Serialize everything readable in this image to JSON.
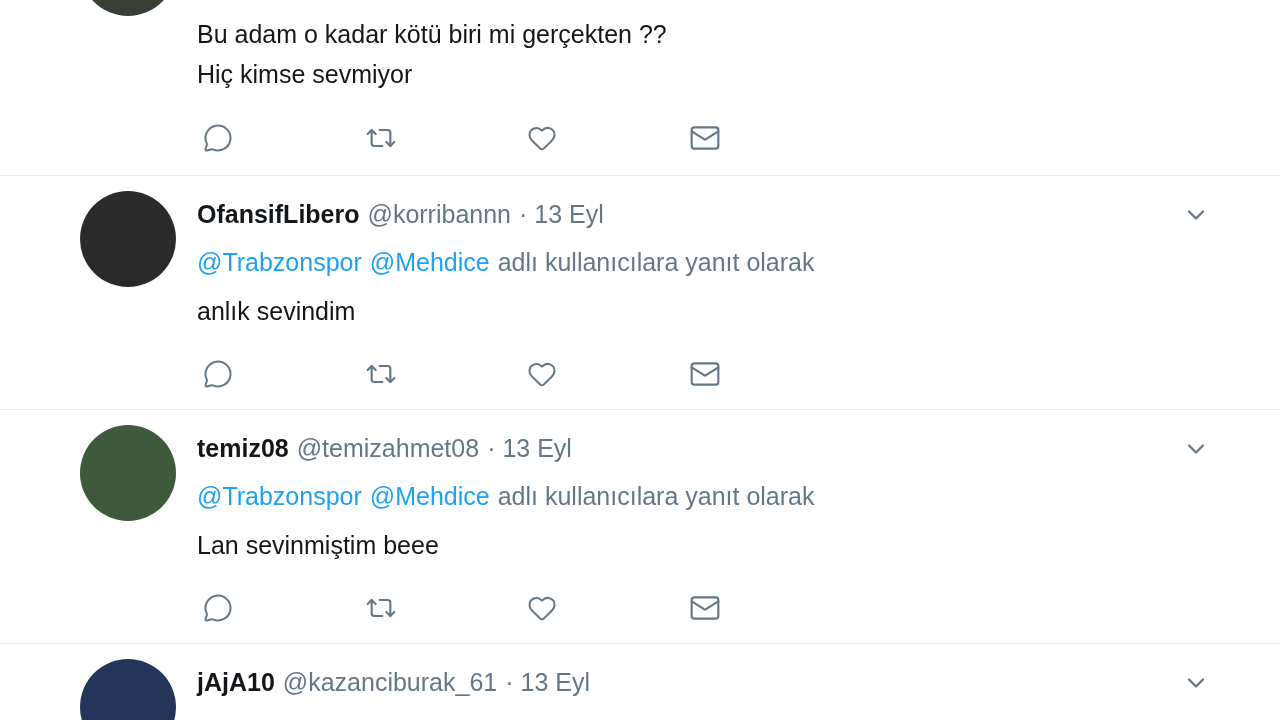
{
  "tweets": [
    {
      "body": [
        "Bu adam o kadar kötü biri mi gerçekten ??",
        "Hiç kimse sevmiyor"
      ]
    },
    {
      "name": "OfansifLibero",
      "handle": "@korribannn",
      "date": "· 13 Eyl",
      "reply_to": {
        "mentions": [
          "@Trabzonspor",
          "@Mehdice"
        ],
        "suffix": "adlı kullanıcılara yanıt olarak"
      },
      "body": [
        "anlık sevindim"
      ]
    },
    {
      "name": "temiz08",
      "handle": "@temizahmet08",
      "date": "· 13 Eyl",
      "reply_to": {
        "mentions": [
          "@Trabzonspor",
          "@Mehdice"
        ],
        "suffix": "adlı kullanıcılara yanıt olarak"
      },
      "body": [
        "Lan sevinmiştim beee"
      ]
    },
    {
      "name": "jAjA10",
      "handle": "@kazanciburak_61",
      "date": "· 13 Eyl"
    }
  ]
}
